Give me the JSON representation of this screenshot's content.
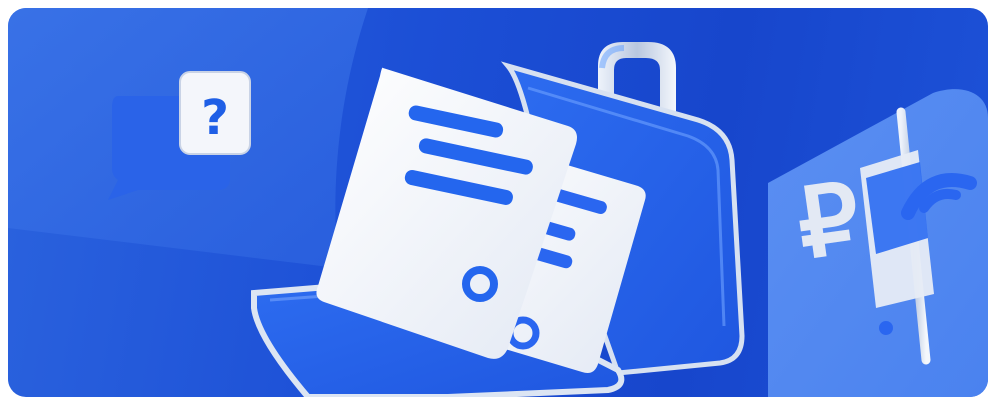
{
  "banner": {
    "name": "documents-briefcase-banner",
    "question_glyph": "?",
    "ruble_glyph": "₽",
    "colors": {
      "background": "#1c4fd6",
      "accent": "#2f6bf0",
      "paper": "#f2f5fb",
      "chrome": "#d5deec"
    },
    "icons": [
      "question-chat-bubble-icon",
      "briefcase-icon",
      "document-icon",
      "ruble-sign-icon",
      "signal-icon"
    ]
  }
}
